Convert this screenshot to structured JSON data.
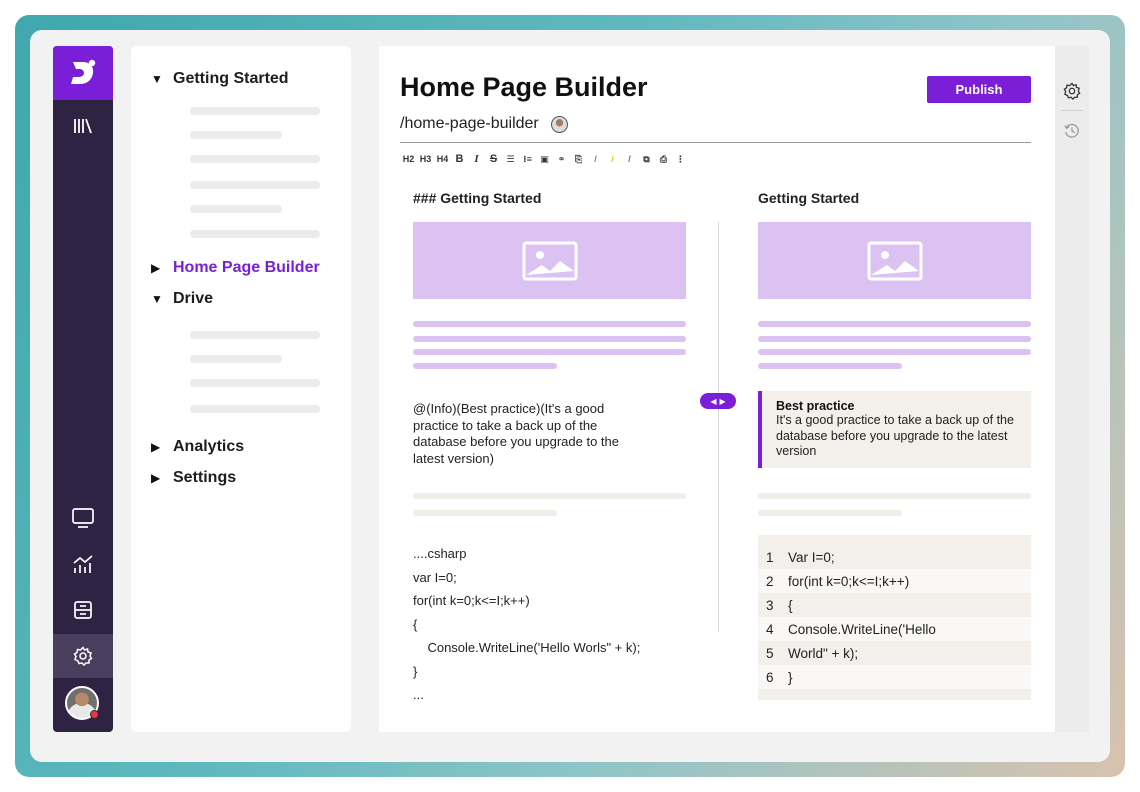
{
  "rail": {
    "icons": [
      "logo-icon",
      "library-icon",
      "monitor-icon",
      "analytics-icon",
      "archive-icon",
      "settings-icon"
    ]
  },
  "tree": {
    "nodes": [
      {
        "label": "Getting Started",
        "expanded": true
      },
      {
        "label": "Home Page Builder",
        "expanded": false,
        "active": true
      },
      {
        "label": "Drive",
        "expanded": true
      },
      {
        "label": "Analytics",
        "expanded": false
      },
      {
        "label": "Settings",
        "expanded": false
      }
    ]
  },
  "editor": {
    "title": "Home Page Builder",
    "slug": "/home-page-builder",
    "publish_label": "Publish",
    "toolbar": [
      "H2",
      "H3",
      "H4",
      "B",
      "I",
      "S",
      "☰",
      "⁝≡",
      "▣",
      "⚭",
      "⎘",
      "/",
      "/",
      "/",
      "⧉",
      "⎙",
      "⋮"
    ],
    "source_heading": "### Getting Started",
    "preview_heading": "Getting Started",
    "source_callout": "@(Info)(Best practice)(It's a good practice to take a back up of the database before you upgrade to the latest version)",
    "callout_title": "Best practice",
    "callout_body": "It's a good practice to take a back up of the database before you upgrade to the latest version",
    "source_code": [
      "....csharp",
      "var I=0;",
      "for(int k=0;k<=I;k++)",
      "{",
      "    Console.WriteLine('Hello Worls\" + k);",
      "}",
      "..."
    ],
    "preview_code": [
      {
        "n": "1",
        "text": "Var I=0;"
      },
      {
        "n": "2",
        "text": "for(int k=0;k<=I;k++)"
      },
      {
        "n": "3",
        "text": "{"
      },
      {
        "n": "4",
        "text": "  Console.WriteLine('Hello"
      },
      {
        "n": "5",
        "text": "World\" + k);"
      },
      {
        "n": "6",
        "text": "}"
      }
    ]
  },
  "colors": {
    "accent": "#7b1ed8",
    "rail_bg": "#2e2343",
    "placeholder": "#dcc1f3",
    "callout_bg": "#f3efea"
  }
}
